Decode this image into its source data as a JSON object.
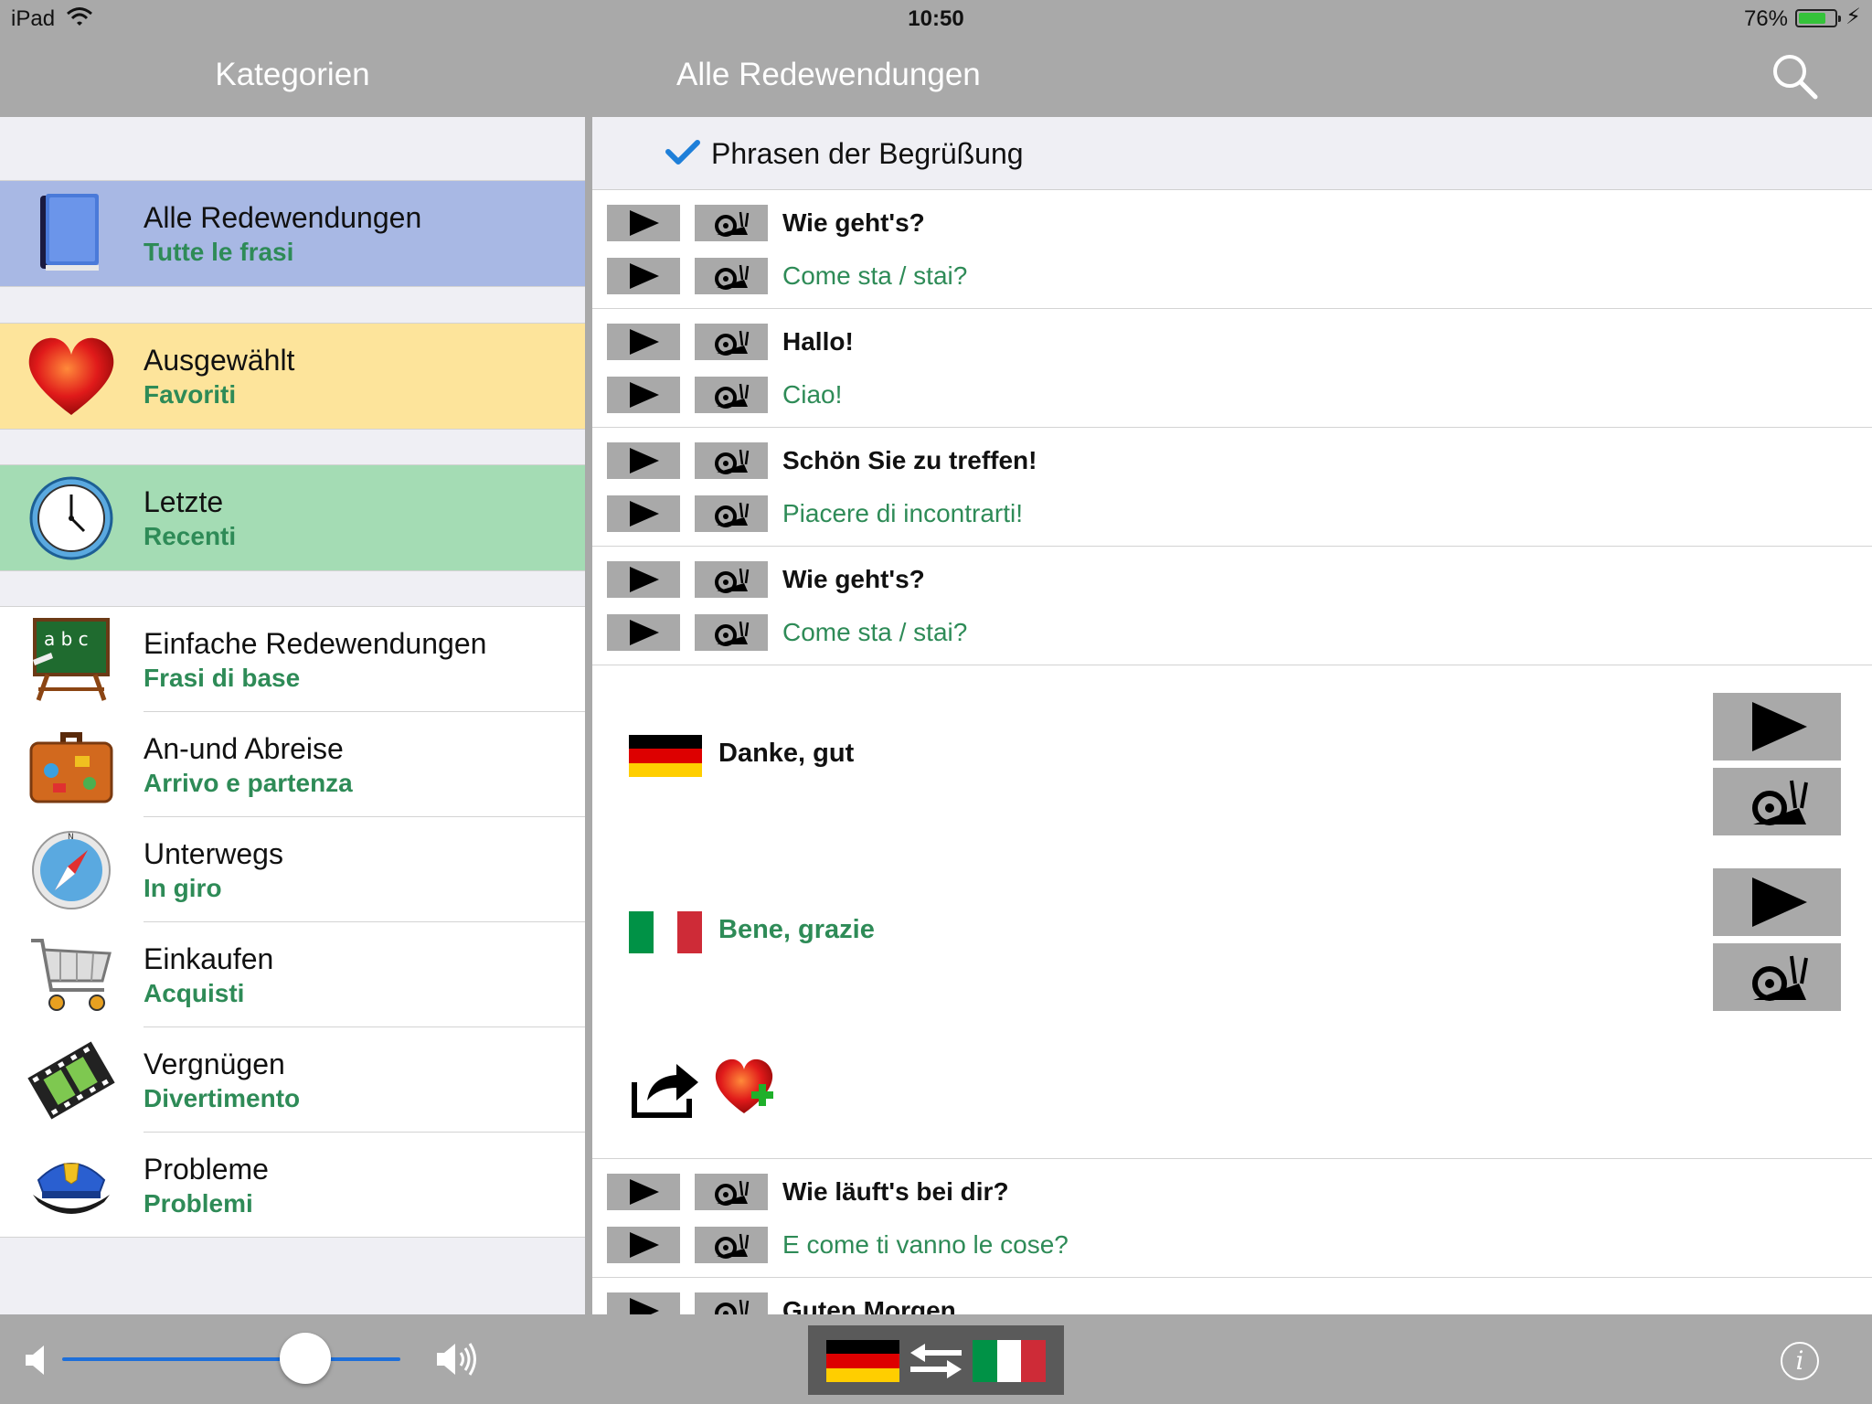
{
  "status_bar": {
    "device": "iPad",
    "time": "10:50",
    "battery_percent": "76%",
    "battery_level": 0.76,
    "battery_color": "#35c33a"
  },
  "nav": {
    "left_title": "Kategorien",
    "main_title": "Alle Redewendungen",
    "search_icon": "search-icon"
  },
  "categories": [
    {
      "de": "Alle Redewendungen",
      "it": "Tutte le frasi",
      "icon": "book-icon",
      "bg": "#a8b8e4"
    },
    {
      "de": "Ausgewählt",
      "it": "Favoriti",
      "icon": "heart-icon",
      "bg": "#fde49b"
    },
    {
      "de": "Letzte",
      "it": "Recenti",
      "icon": "clock-icon",
      "bg": "#a4dcb4"
    },
    {
      "de": "Einfache Redewendungen",
      "it": "Frasi di base",
      "icon": "chalkboard-icon"
    },
    {
      "de": "An-und Abreise",
      "it": "Arrivo e partenza",
      "icon": "suitcase-icon"
    },
    {
      "de": "Unterwegs",
      "it": "In giro",
      "icon": "compass-icon"
    },
    {
      "de": "Einkaufen",
      "it": "Acquisti",
      "icon": "shopping-cart-icon"
    },
    {
      "de": "Vergnügen",
      "it": "Divertimento",
      "icon": "film-strip-icon"
    },
    {
      "de": "Probleme",
      "it": "Problemi",
      "icon": "police-cap-icon"
    }
  ],
  "section": {
    "title": "Phrasen der Begrüßung",
    "icon": "checkmark-icon"
  },
  "phrases": [
    {
      "de": "Wie geht's?",
      "it": "Come sta / stai?"
    },
    {
      "de": "Hallo!",
      "it": "Ciao!"
    },
    {
      "de": "Schön Sie zu treffen!",
      "it": "Piacere di incontrarti!"
    },
    {
      "de": "Wie geht's?",
      "it": "Come sta / stai?"
    }
  ],
  "detail": {
    "de": "Danke, gut",
    "it": "Bene, grazie",
    "de_flag": "german-flag-icon",
    "it_flag": "italian-flag-icon",
    "share_icon": "share-icon",
    "favorite_icon": "heart-plus-icon"
  },
  "phrases_after": [
    {
      "de": "Wie läuft's bei dir?",
      "it": "E come ti vanno le cose?"
    },
    {
      "de": "Guten Morgen",
      "it": ""
    }
  ],
  "toolbar": {
    "volume_level": 0.72,
    "volume_low_icon": "speaker-low-icon",
    "volume_high_icon": "speaker-high-icon",
    "swap_icon": "swap-arrows-icon",
    "info_label": "i"
  },
  "colors": {
    "chrome": "#a9a9a9",
    "italian_text": "#2e8b57",
    "button_gray": "#a9a9a9"
  }
}
